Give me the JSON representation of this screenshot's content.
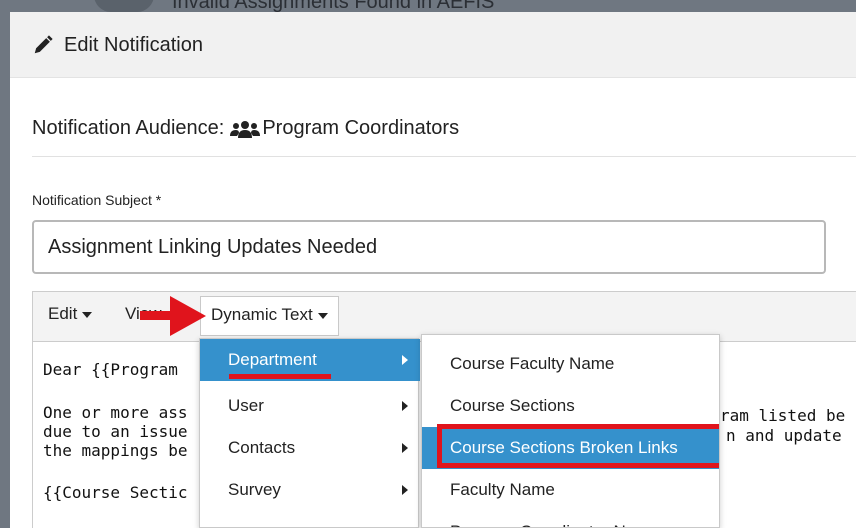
{
  "background": {
    "title": "Invalid Assignments Found in AEFIS"
  },
  "modal": {
    "title": "Edit Notification",
    "audience_label": "Notification Audience:",
    "audience_value": "Program Coordinators",
    "subject_label": "Notification Subject *",
    "subject_value": "Assignment Linking Updates Needed"
  },
  "editor": {
    "menus": {
      "edit": "Edit",
      "view": "View",
      "dynamic": "Dynamic Text"
    },
    "lines": [
      "Dear {{Program",
      "One or more ass",
      "due to an issue",
      "the mappings be",
      "{{Course Sectic"
    ],
    "peek": {
      "line1": "ram listed be",
      "line2": "n and update"
    }
  },
  "dropdown_primary": [
    {
      "label": "Department",
      "active": true
    },
    {
      "label": "User",
      "active": false
    },
    {
      "label": "Contacts",
      "active": false
    },
    {
      "label": "Survey",
      "active": false
    }
  ],
  "dropdown_secondary": [
    {
      "label": "Course Faculty Name",
      "active": false
    },
    {
      "label": "Course Sections",
      "active": false
    },
    {
      "label": "Course Sections Broken Links",
      "active": true
    },
    {
      "label": "Faculty Name",
      "active": false
    },
    {
      "label": "Program Coordinator Name",
      "active": false
    }
  ],
  "colors": {
    "accent": "#3591cc",
    "annotation_red": "#e0141c"
  },
  "icons": {
    "header": "pencil-icon",
    "audience": "users-icon"
  }
}
